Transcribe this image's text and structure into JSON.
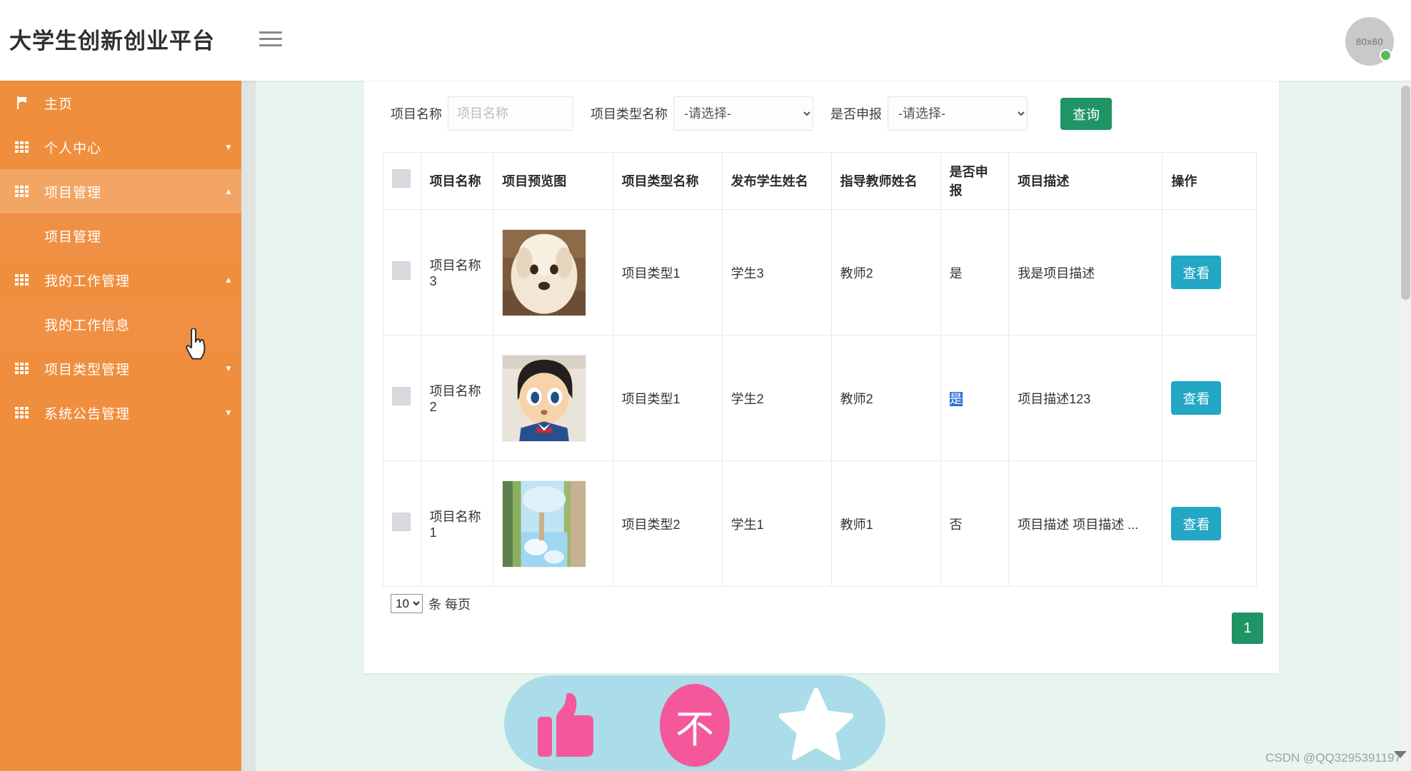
{
  "header": {
    "title": "大学生创新创业平台",
    "menu_icon": "hamburger-icon",
    "avatar_label": "80x80"
  },
  "sidebar": {
    "items": [
      {
        "label": "主页",
        "icon": "flag-icon",
        "caret": "",
        "active": false,
        "sub": false
      },
      {
        "label": "个人中心",
        "icon": "grid-icon",
        "caret": "▼",
        "active": false,
        "sub": false
      },
      {
        "label": "项目管理",
        "icon": "grid-icon",
        "caret": "▲",
        "active": true,
        "sub": false
      },
      {
        "label": "项目管理",
        "icon": "",
        "caret": "",
        "active": false,
        "sub": true
      },
      {
        "label": "我的工作管理",
        "icon": "grid-icon",
        "caret": "▲",
        "active": false,
        "sub": false
      },
      {
        "label": "我的工作信息",
        "icon": "",
        "caret": "",
        "active": false,
        "sub": true
      },
      {
        "label": "项目类型管理",
        "icon": "grid-icon",
        "caret": "▼",
        "active": false,
        "sub": false
      },
      {
        "label": "系统公告管理",
        "icon": "grid-icon",
        "caret": "▼",
        "active": false,
        "sub": false
      }
    ]
  },
  "filters": {
    "name_label": "项目名称",
    "name_placeholder": "项目名称",
    "name_value": "",
    "type_label": "项目类型名称",
    "type_value": "-请选择-",
    "declare_label": "是否申报",
    "declare_value": "-请选择-",
    "search_button": "查询"
  },
  "table": {
    "headers": [
      "项目名称",
      "项目预览图",
      "项目类型名称",
      "发布学生姓名",
      "指导教师姓名",
      "是否申报",
      "项目描述",
      "操作"
    ],
    "rows": [
      {
        "name": "项目名称3",
        "image": "puppy-thumbnail",
        "type": "项目类型1",
        "student": "学生3",
        "teacher": "教师2",
        "declared": "是",
        "declared_selected": false,
        "description": "我是项目描述",
        "action": "查看"
      },
      {
        "name": "项目名称2",
        "image": "conan-thumbnail",
        "type": "项目类型1",
        "student": "学生2",
        "teacher": "教师2",
        "declared": "是",
        "declared_selected": true,
        "description": "项目描述123",
        "action": "查看"
      },
      {
        "name": "项目名称1",
        "image": "landscape-thumbnail",
        "type": "项目类型2",
        "student": "学生1",
        "teacher": "教师1",
        "declared": "否",
        "declared_selected": false,
        "description": "项目描述 项目描述 ...",
        "action": "查看"
      }
    ]
  },
  "pagination": {
    "page_size": "10",
    "page_size_suffix": "条 每页",
    "current_page": "1"
  },
  "reactions": {
    "like_icon": "thumbs-up-icon",
    "dislike_label": "不",
    "star_icon": "star-icon"
  },
  "watermark": "CSDN @QQ3295391197",
  "colors": {
    "sidebar": "#ef8e3c",
    "sidebar_active": "#f3a565",
    "primary_green": "#1f9465",
    "view_button": "#22a7c4",
    "content_bg": "#e8f4ee",
    "reaction_bar": "#aadde9",
    "reaction_pink": "#f4589b",
    "selection_blue": "#2a6fd6"
  }
}
